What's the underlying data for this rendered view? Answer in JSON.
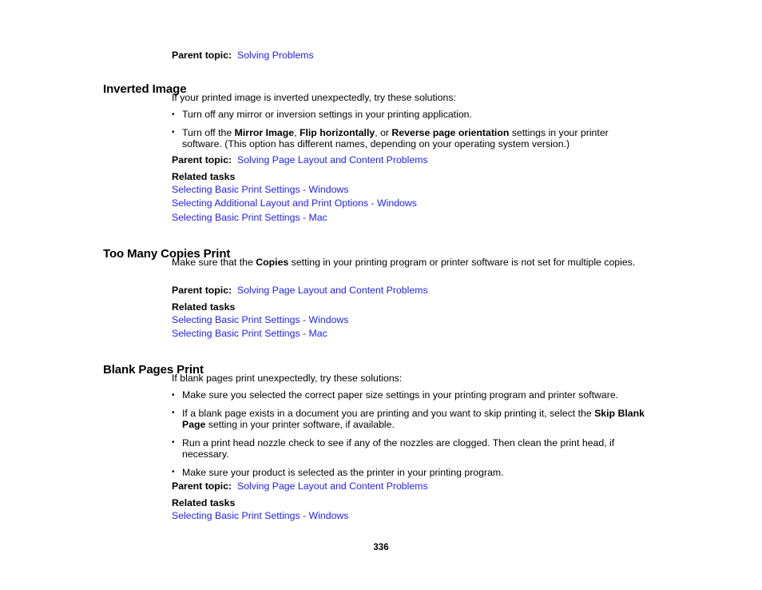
{
  "document": {
    "page_number": "336",
    "link_color": "#2222ee",
    "text_color": "#000000",
    "background_color": "#ffffff"
  },
  "top_parent_topic": {
    "label": "Parent topic:",
    "link": "Solving Problems"
  },
  "sections": [
    {
      "heading": "Inverted Image",
      "intro": "If your printed image is inverted unexpectedly, try these solutions:",
      "bullets": [
        {
          "parts": [
            {
              "type": "text",
              "value": "Turn off any mirror or inversion settings in your printing application."
            }
          ]
        },
        {
          "parts": [
            {
              "type": "text",
              "value": "Turn off the "
            },
            {
              "type": "bold",
              "value": "Mirror Image"
            },
            {
              "type": "text",
              "value": ", "
            },
            {
              "type": "bold",
              "value": "Flip horizontally"
            },
            {
              "type": "text",
              "value": ", or "
            },
            {
              "type": "bold",
              "value": "Reverse page orientation"
            },
            {
              "type": "text",
              "value": " settings in your printer software. (This option has different names, depending on your operating system version.)"
            }
          ]
        }
      ],
      "parent_topic": {
        "label": "Parent topic:",
        "link": "Solving Page Layout and Content Problems"
      },
      "related_tasks_label": "Related tasks",
      "related_tasks": [
        "Selecting Basic Print Settings - Windows",
        "Selecting Additional Layout and Print Options - Windows",
        "Selecting Basic Print Settings - Mac"
      ]
    },
    {
      "heading": "Too Many Copies Print",
      "intro_parts": [
        {
          "type": "text",
          "value": "Make sure that the "
        },
        {
          "type": "bold",
          "value": "Copies"
        },
        {
          "type": "text",
          "value": " setting in your printing program or printer software is not set for multiple copies."
        }
      ],
      "parent_topic": {
        "label": "Parent topic:",
        "link": "Solving Page Layout and Content Problems"
      },
      "related_tasks_label": "Related tasks",
      "related_tasks": [
        "Selecting Basic Print Settings - Windows",
        "Selecting Basic Print Settings - Mac"
      ]
    },
    {
      "heading": "Blank Pages Print",
      "intro": "If blank pages print unexpectedly, try these solutions:",
      "bullets": [
        {
          "parts": [
            {
              "type": "text",
              "value": "Make sure you selected the correct paper size settings in your printing program and printer software."
            }
          ]
        },
        {
          "parts": [
            {
              "type": "text",
              "value": "If a blank page exists in a document you are printing and you want to skip printing it, select the "
            },
            {
              "type": "bold",
              "value": "Skip Blank Page"
            },
            {
              "type": "text",
              "value": " setting in your printer software, if available."
            }
          ]
        },
        {
          "parts": [
            {
              "type": "text",
              "value": "Run a print head nozzle check to see if any of the nozzles are clogged. Then clean the print head, if necessary."
            }
          ]
        },
        {
          "parts": [
            {
              "type": "text",
              "value": "Make sure your product is selected as the printer in your printing program."
            }
          ]
        }
      ],
      "parent_topic": {
        "label": "Parent topic:",
        "link": "Solving Page Layout and Content Problems"
      },
      "related_tasks_label": "Related tasks",
      "related_tasks": [
        "Selecting Basic Print Settings - Windows"
      ]
    }
  ]
}
